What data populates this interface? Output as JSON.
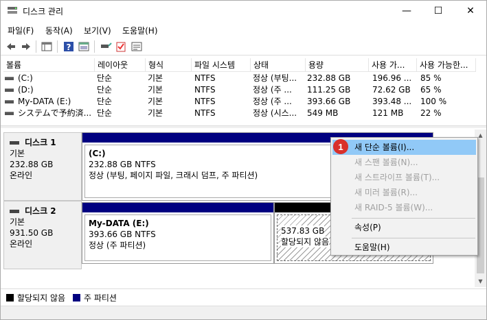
{
  "window": {
    "title": "디스크 관리",
    "minimize_glyph": "—",
    "maximize_glyph": "☐",
    "close_glyph": "✕"
  },
  "menu": [
    "파일(F)",
    "동작(A)",
    "보기(V)",
    "도움말(H)"
  ],
  "volume_table": {
    "headers": [
      "볼륨",
      "레이아웃",
      "형식",
      "파일 시스템",
      "상태",
      "용량",
      "사용 가...",
      "사용 가능한..."
    ],
    "rows": [
      [
        "(C:)",
        "단순",
        "기본",
        "NTFS",
        "정상 (부팅...",
        "232.88 GB",
        "196.96 ...",
        "85 %"
      ],
      [
        "(D:)",
        "단순",
        "기본",
        "NTFS",
        "정상 (주 ...",
        "111.25 GB",
        "72.62 GB",
        "65 %"
      ],
      [
        "My-DATA (E:)",
        "단순",
        "기본",
        "NTFS",
        "정상 (주 ...",
        "393.66 GB",
        "393.48 ...",
        "100 %"
      ],
      [
        "システムで予約済...",
        "단순",
        "기본",
        "NTFS",
        "정상 (시스...",
        "549 MB",
        "121 MB",
        "22 %"
      ]
    ]
  },
  "disks": [
    {
      "name": "디스크 1",
      "type": "기본",
      "size": "232.88 GB",
      "status": "온라인",
      "partition": {
        "label": "(C:)",
        "size_fs": "232.88 GB NTFS",
        "status": "정상 (부팅, 페이지 파일, 크래시 덤프, 주 파티션)"
      }
    },
    {
      "name": "디스크 2",
      "type": "기본",
      "size": "931.50 GB",
      "status": "온라인",
      "partition": {
        "label": "My-DATA  (E:)",
        "size_fs": "393.66 GB NTFS",
        "status": "정상 (주 파티션)"
      },
      "unallocated": {
        "size": "537.83 GB",
        "status": "할당되지 않음"
      }
    }
  ],
  "legend": [
    {
      "label": "할당되지 않음",
      "color": "#000000"
    },
    {
      "label": "주 파티션",
      "color": "#000080"
    }
  ],
  "context_menu": {
    "badge": "1",
    "items": [
      {
        "label": "새 단순 볼륨(I)...",
        "enabled": true,
        "highlighted": true
      },
      {
        "label": "새 스팬 볼륨(N)...",
        "enabled": false
      },
      {
        "label": "새 스트라이프 볼륨(T)...",
        "enabled": false
      },
      {
        "label": "새 미러 볼륨(R)...",
        "enabled": false
      },
      {
        "label": "새 RAID-5 볼륨(W)...",
        "enabled": false
      },
      {
        "label": "속성(P)",
        "enabled": true
      },
      {
        "label": "도움말(H)",
        "enabled": true
      }
    ]
  },
  "colors": {
    "primary_partition": "#000080",
    "unallocated": "#000000",
    "menu_highlight": "#91c9f7",
    "badge": "#d9302b"
  }
}
